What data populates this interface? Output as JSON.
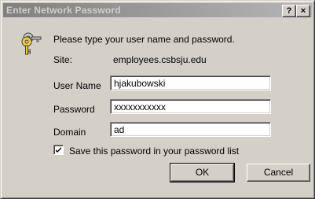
{
  "window": {
    "title": "Enter Network Password",
    "help_label": "?",
    "close_label": "×"
  },
  "dialog": {
    "prompt": "Please type your user name and password.",
    "site_label": "Site:",
    "site_value": "employees.csbsju.edu",
    "username_label": "User Name",
    "username_value": "hjakubowski",
    "password_label": "Password",
    "password_value": "xxxxxxxxxxx",
    "domain_label": "Domain",
    "domain_value": "ad",
    "save_password_label": "Save this password in your password list",
    "save_password_checked": true
  },
  "buttons": {
    "ok_label": "OK",
    "cancel_label": "Cancel"
  },
  "icons": {
    "key": "keys-icon"
  }
}
